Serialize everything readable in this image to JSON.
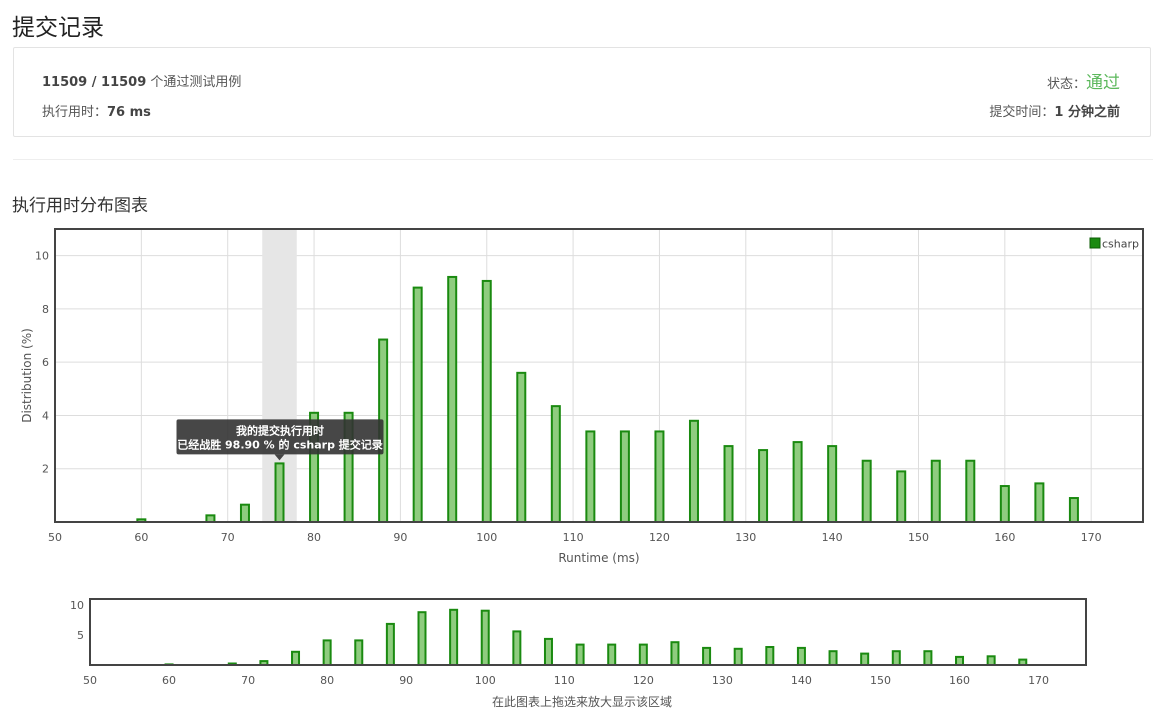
{
  "header": {
    "title": "提交记录"
  },
  "summary": {
    "cases_passed": "11509 / 11509",
    "cases_suffix": "个通过测试用例",
    "runtime_label": "执行用时：",
    "runtime_value": "76 ms",
    "status_label": "状态：",
    "status_value": "通过",
    "submit_time_label": "提交时间：",
    "submit_time_value": "1 分钟之前"
  },
  "section": {
    "title": "执行用时分布图表"
  },
  "tooltip": {
    "line1": "我的提交执行用时",
    "line2": "已经战胜 98.90 % 的 csharp 提交记录"
  },
  "navigator": {
    "hint": "在此图表上拖选来放大显示该区域"
  },
  "colors": {
    "bar_fill": "#8fcc7f",
    "bar_stroke": "#1a8a10",
    "accepted": "#5cb85c",
    "highlight_band": "#e6e6e6"
  },
  "chart_data": [
    {
      "type": "bar",
      "xlabel": "Runtime (ms)",
      "ylabel": "Distribution (%)",
      "xlim": [
        50,
        176
      ],
      "ylim": [
        0,
        11
      ],
      "xticks": [
        50,
        60,
        70,
        80,
        90,
        100,
        110,
        120,
        130,
        140,
        150,
        160,
        170
      ],
      "yticks": [
        2,
        4,
        6,
        8,
        10
      ],
      "grid": true,
      "legend_position": "top-right",
      "highlight": {
        "from": 74,
        "to": 78
      },
      "series": [
        {
          "name": "csharp",
          "x": [
            60,
            68,
            72,
            76,
            80,
            84,
            88,
            92,
            96,
            100,
            104,
            108,
            112,
            116,
            120,
            124,
            128,
            132,
            136,
            140,
            144,
            148,
            152,
            156,
            160,
            164,
            168
          ],
          "values": [
            0.1,
            0.25,
            0.65,
            2.2,
            4.1,
            4.1,
            6.85,
            8.8,
            9.2,
            9.05,
            5.6,
            4.35,
            3.4,
            3.4,
            3.4,
            3.8,
            2.85,
            2.7,
            3.0,
            2.85,
            2.3,
            1.9,
            2.3,
            2.3,
            1.35,
            1.45,
            0.9
          ]
        }
      ]
    },
    {
      "type": "bar",
      "xlim": [
        50,
        176
      ],
      "ylim": [
        0,
        11
      ],
      "xticks": [
        50,
        60,
        70,
        80,
        90,
        100,
        110,
        120,
        130,
        140,
        150,
        160,
        170
      ],
      "yticks": [
        5,
        10
      ],
      "series": [
        {
          "x": [
            60,
            68,
            72,
            76,
            80,
            84,
            88,
            92,
            96,
            100,
            104,
            108,
            112,
            116,
            120,
            124,
            128,
            132,
            136,
            140,
            144,
            148,
            152,
            156,
            160,
            164,
            168
          ],
          "values": [
            0.1,
            0.25,
            0.65,
            2.2,
            4.1,
            4.1,
            6.85,
            8.8,
            9.2,
            9.05,
            5.6,
            4.35,
            3.4,
            3.4,
            3.4,
            3.8,
            2.85,
            2.7,
            3.0,
            2.85,
            2.3,
            1.9,
            2.3,
            2.3,
            1.35,
            1.45,
            0.9
          ]
        }
      ]
    }
  ]
}
